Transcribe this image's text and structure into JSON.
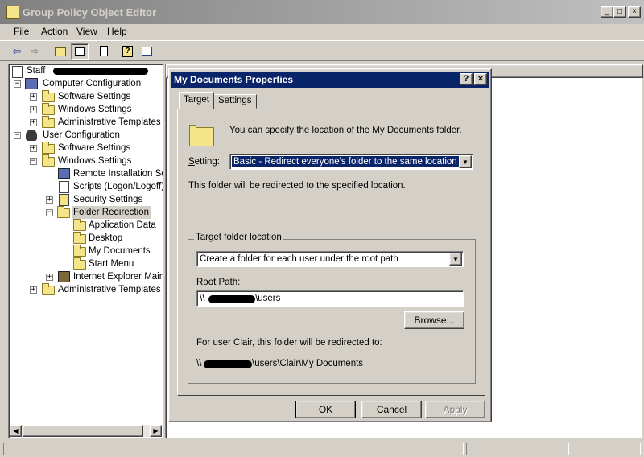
{
  "window": {
    "title": "Group Policy Object Editor",
    "minimize": "_",
    "maximize": "□",
    "close": "×"
  },
  "menu": [
    "File",
    "Action",
    "View",
    "Help"
  ],
  "tree": {
    "root": "Staff",
    "computer_config": "Computer Configuration",
    "cc_software": "Software Settings",
    "cc_windows": "Windows Settings",
    "cc_admin": "Administrative Templates",
    "user_config": "User Configuration",
    "uc_software": "Software Settings",
    "uc_windows": "Windows Settings",
    "remote_install": "Remote Installation Ser",
    "scripts": "Scripts (Logon/Logoff)",
    "security": "Security Settings",
    "folder_redirection": "Folder Redirection",
    "app_data": "Application Data",
    "desktop": "Desktop",
    "my_documents": "My Documents",
    "start_menu": "Start Menu",
    "ie_maint": "Internet Explorer Maint",
    "uc_admin": "Administrative Templates"
  },
  "dialog": {
    "title": "My Documents Properties",
    "help_btn": "?",
    "close_btn": "×",
    "tabs": [
      "Target",
      "Settings"
    ],
    "intro": "You can specify the location of the My Documents folder.",
    "setting_label": "Setting:",
    "setting_value": "Basic - Redirect everyone's folder to the same location",
    "redirect_note": "This folder will be redirected to the specified location.",
    "target_group": "Target folder location",
    "target_value": "Create a folder for each user under the root path",
    "root_path_label": "Root Path:",
    "root_path_prefix": "\\\\",
    "root_path_suffix": "\\users",
    "browse": "Browse...",
    "for_user": "For user Clair, this folder will be redirected to:",
    "redirect_prefix": "\\\\",
    "redirect_suffix": "\\users\\Clair\\My Documents",
    "ok": "OK",
    "cancel": "Cancel",
    "apply": "Apply"
  }
}
